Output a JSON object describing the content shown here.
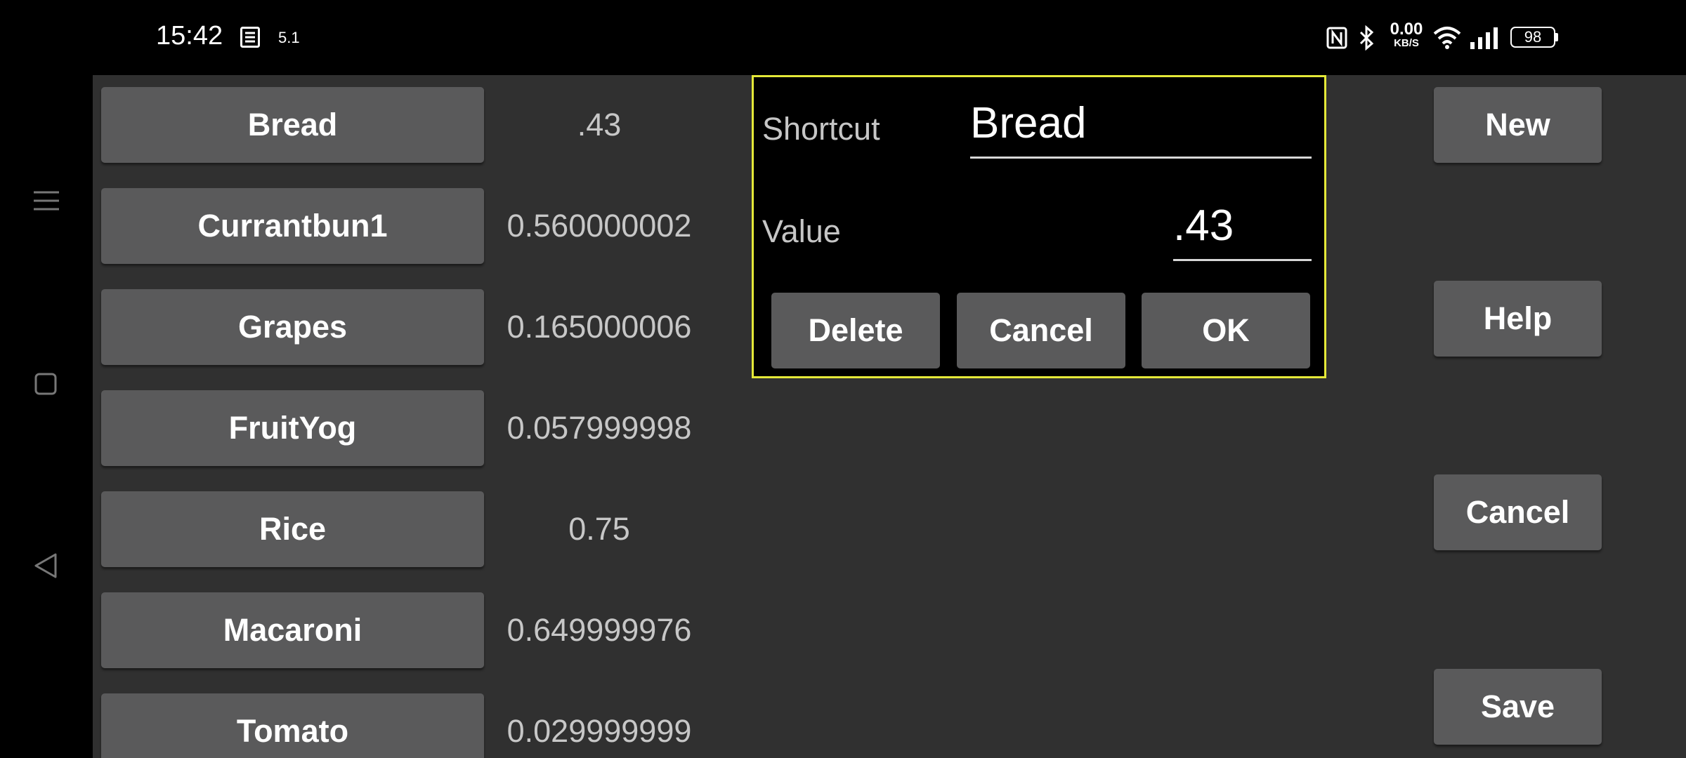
{
  "status_bar": {
    "time": "15:42",
    "small_indicator": "5.1",
    "net_speed_value": "0.00",
    "net_speed_unit": "KB/S",
    "battery_level": "98",
    "icons": [
      "notification-icon",
      "nfc-icon",
      "bluetooth-icon",
      "wifi-icon",
      "signal-icon",
      "battery-icon"
    ]
  },
  "nav": {
    "icons": [
      "menu-icon",
      "home-square-icon",
      "back-icon"
    ]
  },
  "items": [
    {
      "name": "Bread",
      "value": ".43"
    },
    {
      "name": "Currantbun1",
      "value": "0.560000002"
    },
    {
      "name": "Grapes",
      "value": "0.165000006"
    },
    {
      "name": "FruitYog",
      "value": "0.057999998"
    },
    {
      "name": "Rice",
      "value": "0.75"
    },
    {
      "name": "Macaroni",
      "value": "0.649999976"
    },
    {
      "name": "Tomato",
      "value": "0.029999999"
    }
  ],
  "side_buttons": {
    "new": "New",
    "help": "Help",
    "cancel": "Cancel",
    "save": "Save"
  },
  "dialog": {
    "shortcut_label": "Shortcut",
    "shortcut_value": "Bread",
    "value_label": "Value",
    "value_value": ".43",
    "delete_label": "Delete",
    "cancel_label": "Cancel",
    "ok_label": "OK",
    "border_color": "#e4e838"
  },
  "colors": {
    "background": "#303030",
    "button": "#5a5a5b",
    "value_text": "#c7c7c7"
  }
}
